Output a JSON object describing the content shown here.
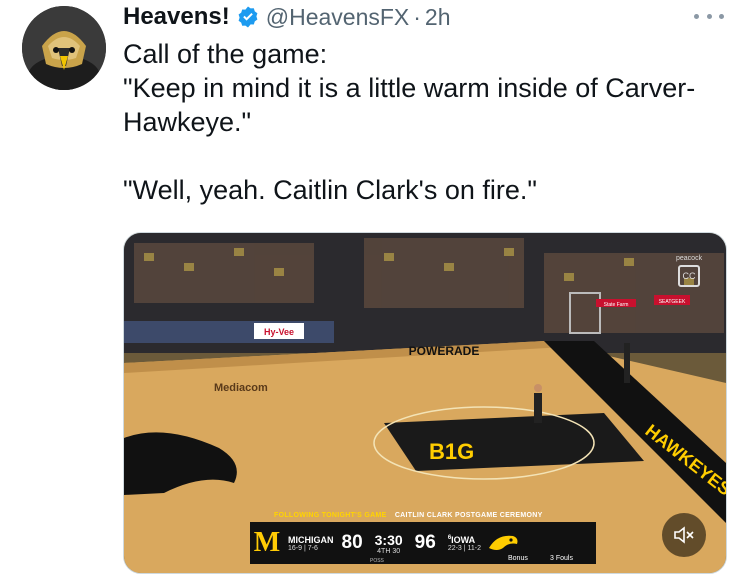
{
  "tweet": {
    "display_name": "Heavens!",
    "handle": "@HeavensFX",
    "separator": "·",
    "time": "2h",
    "more_icon": "more-horizontal-icon",
    "verified_icon": "verified-badge-icon",
    "verified_color": "#1d9bf0",
    "text": "Call of the game:\n\"Keep in mind it is a little warm inside of Carver-Hawkeye.\"\n\n\"Well, yeah. Caitlin Clark's on fire.\""
  },
  "video": {
    "ticker_main": "FOLLOWING TONIGHT'S GAME",
    "ticker_promo": "CAITLIN CLARK POSTGAME CEREMONY",
    "away_logo": "M",
    "away_name": "MICHIGAN",
    "away_record": "16-9 | 7-6",
    "away_score": "80",
    "clock": "3:30",
    "period": "4TH",
    "shot_clock": "30",
    "poss_label": "POSS",
    "home_score": "96",
    "home_name": "IOWA",
    "home_rank": "6",
    "home_record": "22-3 | 11-2",
    "bonus_label": "Bonus",
    "fouls_label": "3 Fouls",
    "network_label": "peacock",
    "cc_label": "CC",
    "mute_icon": "volume-muted-icon",
    "court_signage": [
      "Hy-Vee",
      "POWERADE",
      "Mediacom",
      "B1G",
      "HAWKEYES",
      "SEATGEEK",
      "State Farm"
    ],
    "colors": {
      "iowa_gold": "#ffcd00",
      "iowa_black": "#111111",
      "michigan_maize": "#ffcb05"
    }
  }
}
